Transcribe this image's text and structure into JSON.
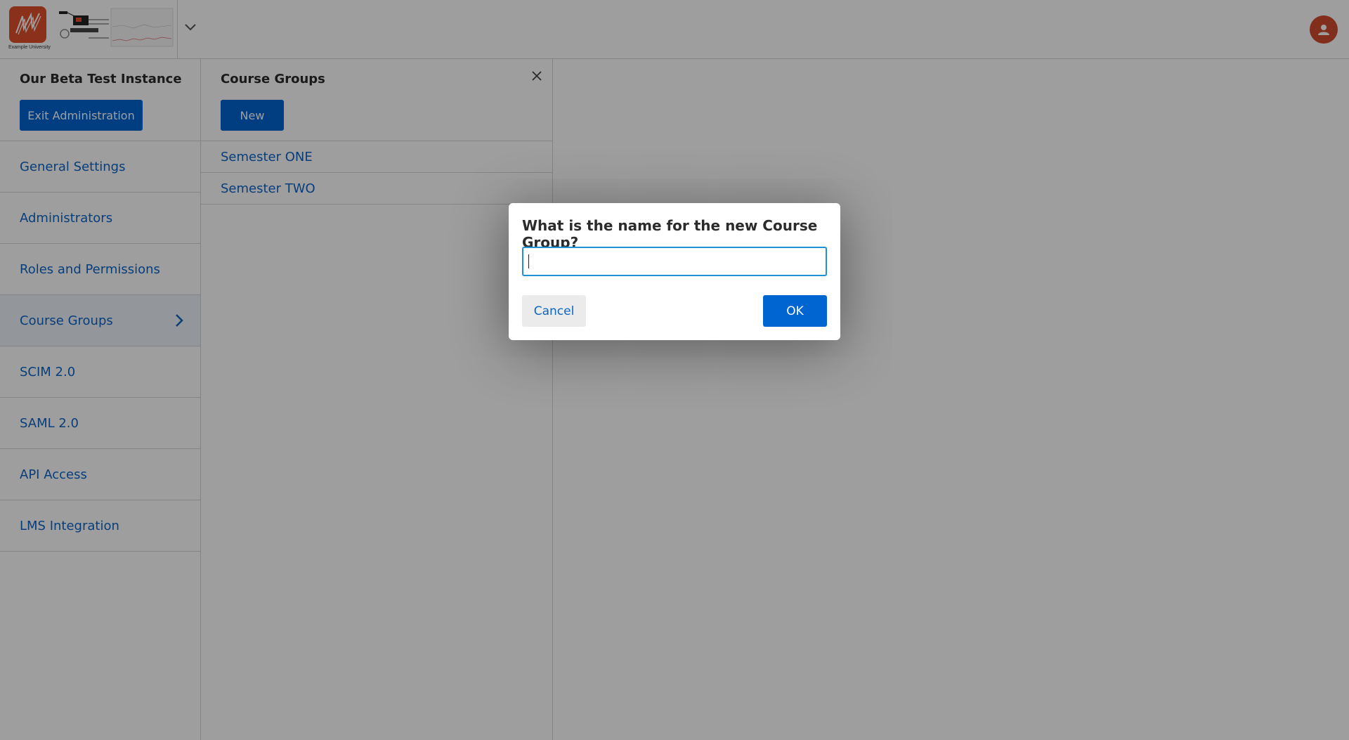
{
  "header": {
    "logo_caption": "Example University",
    "logo_icon": "mw-logo-icon",
    "dropdown_icon": "chevron-down-icon",
    "avatar_icon": "user-icon"
  },
  "sidebar": {
    "title": "Our Beta Test Instance",
    "exit_label": "Exit Administration",
    "items": [
      {
        "label": "General Settings"
      },
      {
        "label": "Administrators"
      },
      {
        "label": "Roles and Permissions"
      },
      {
        "label": "Course Groups",
        "active": true
      },
      {
        "label": "SCIM 2.0"
      },
      {
        "label": "SAML 2.0"
      },
      {
        "label": "API Access"
      },
      {
        "label": "LMS Integration"
      }
    ]
  },
  "panel": {
    "title": "Course Groups",
    "new_label": "New",
    "groups": [
      {
        "label": "Semester ONE"
      },
      {
        "label": "Semester TWO"
      }
    ]
  },
  "dialog": {
    "title": "What is the name for the new Course Group?",
    "input_value": "",
    "cancel_label": "Cancel",
    "ok_label": "OK"
  },
  "colors": {
    "accent": "#0065d1",
    "link": "#0d64c6",
    "logo": "#e1502c",
    "avatar": "#d24b30"
  }
}
